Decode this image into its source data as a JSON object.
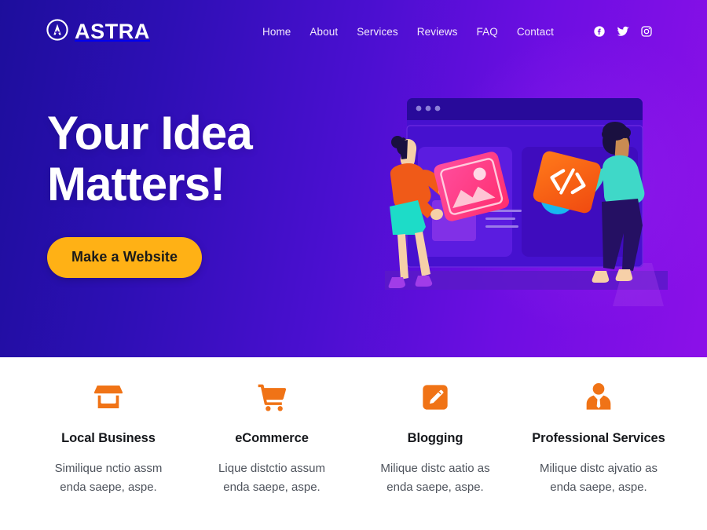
{
  "brand": {
    "name": "ASTRA",
    "logo_icon": "astra-circle-a-icon"
  },
  "nav": {
    "items": [
      {
        "label": "Home"
      },
      {
        "label": "About"
      },
      {
        "label": "Services"
      },
      {
        "label": "Reviews"
      },
      {
        "label": "FAQ"
      },
      {
        "label": "Contact"
      }
    ]
  },
  "social": {
    "items": [
      {
        "icon": "facebook-icon",
        "name": "Facebook"
      },
      {
        "icon": "twitter-icon",
        "name": "Twitter"
      },
      {
        "icon": "instagram-icon",
        "name": "Instagram"
      }
    ]
  },
  "hero": {
    "title_line1": "Your Idea",
    "title_line2": "Matters!",
    "cta_label": "Make a Website",
    "illustration_name": "website-building-illustration"
  },
  "features": {
    "items": [
      {
        "icon": "storefront-icon",
        "title": "Local Business",
        "desc_line1": "Similique nctio assm",
        "desc_line2": "enda saepe, aspe."
      },
      {
        "icon": "shopping-cart-icon",
        "title": "eCommerce",
        "desc_line1": "Lique distctio assum",
        "desc_line2": "enda saepe, aspe."
      },
      {
        "icon": "pencil-square-icon",
        "title": "Blogging",
        "desc_line1": "Milique distc aatio as",
        "desc_line2": "enda saepe, aspe."
      },
      {
        "icon": "businessperson-icon",
        "title": "Professional Services",
        "desc_line1": "Milique distc ajvatio as",
        "desc_line2": "enda saepe, aspe."
      }
    ]
  },
  "colors": {
    "hero_gradient_start": "#1d0e9c",
    "hero_gradient_end": "#8c10e8",
    "cta_background": "#ffb115",
    "cta_text": "#1a1a1a",
    "feature_icon": "#f07316",
    "feature_title": "#16181c",
    "feature_desc": "#4e535c",
    "nav_text": "#f2e9fb"
  }
}
